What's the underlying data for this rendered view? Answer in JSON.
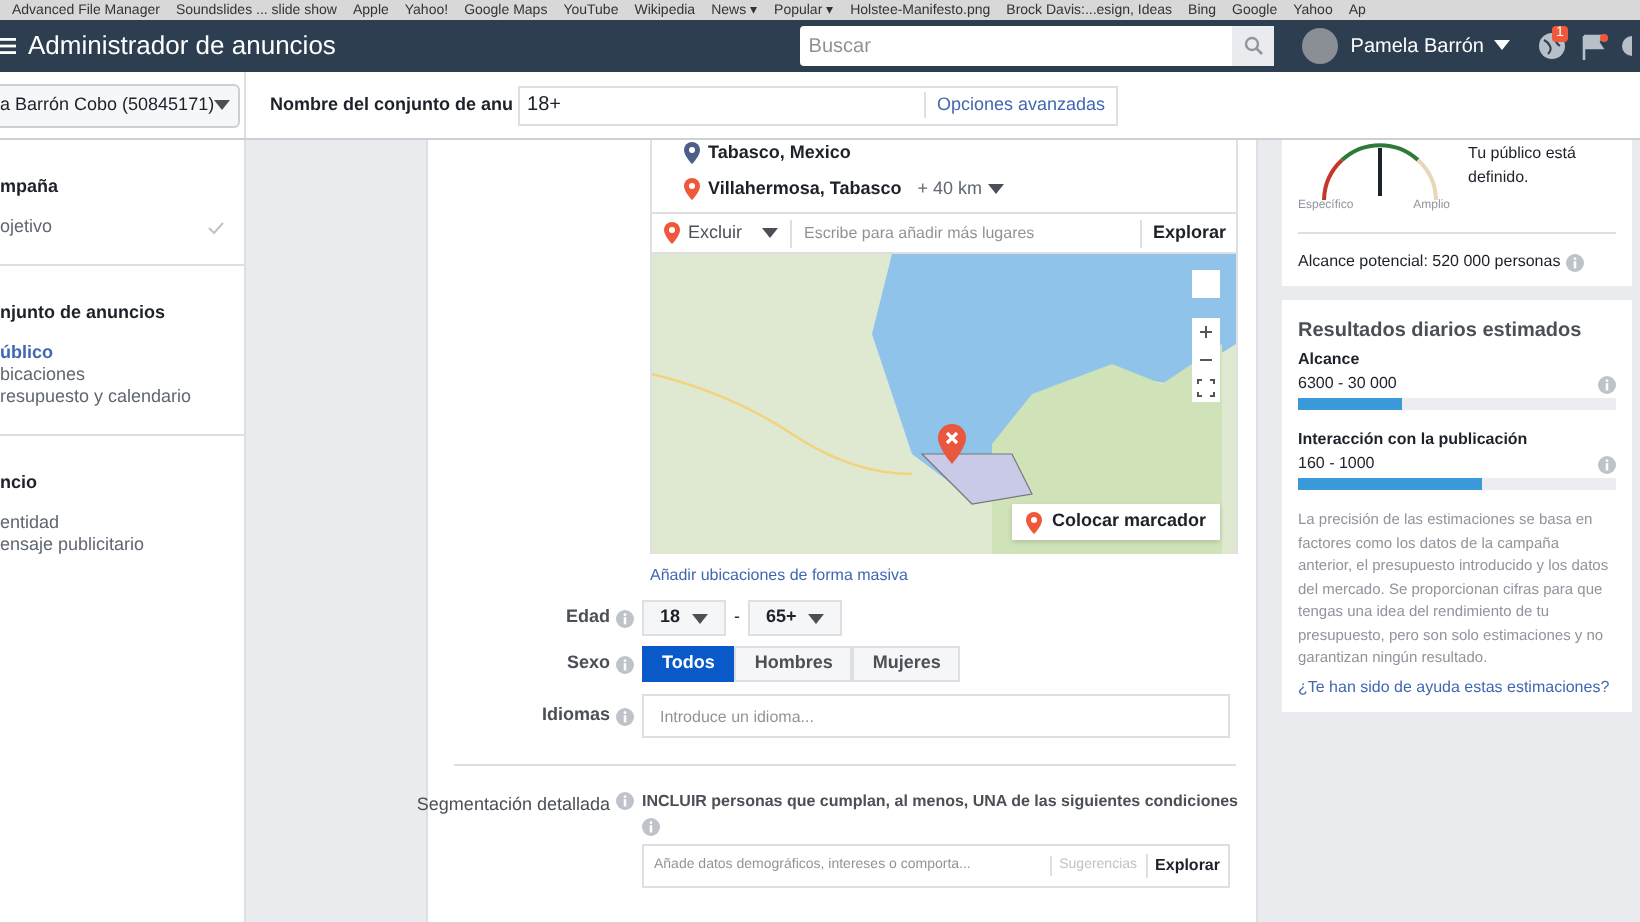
{
  "bookmarks": [
    "Advanced File Manager",
    "Soundslides ... slide show",
    "Apple",
    "Yahoo!",
    "Google Maps",
    "YouTube",
    "Wikipedia",
    "News ▾",
    "Popular ▾",
    "Holstee-Manifesto.png",
    "Brock Davis:...esign, Ideas",
    "Bing",
    "Google",
    "Yahoo",
    "Ap"
  ],
  "header": {
    "title": "Administrador de anuncios",
    "search": {
      "placeholder": "Buscar"
    },
    "user": "Pamela Barrón",
    "notifications": "1"
  },
  "account": "a Barrón Cobo (50845171)",
  "ad_set_name": {
    "label": "Nombre del conjunto de anu",
    "value": "18+",
    "link": "Opciones avanzadas"
  },
  "sidebar": [
    {
      "heading": "mpaña",
      "items": [
        {
          "label": "ojetivo",
          "selected": false,
          "done": true
        }
      ]
    },
    {
      "heading": "njunto de anuncios",
      "items": [
        {
          "label": "úblico",
          "selected": true,
          "done": false
        },
        {
          "label": "bicaciones",
          "selected": false,
          "done": false
        },
        {
          "label": "resupuesto y calendario",
          "selected": false,
          "done": false
        }
      ]
    },
    {
      "heading": "ncio",
      "items": [
        {
          "label": "entidad",
          "selected": false,
          "done": false
        },
        {
          "label": "ensaje publicitario",
          "selected": false,
          "done": false
        }
      ]
    }
  ],
  "locations": [
    {
      "name": "Tabasco, Mexico",
      "kind": "region"
    },
    {
      "name": "Villahermosa, Tabasco",
      "kind": "city",
      "radius": "+ 40 km"
    }
  ],
  "location_bar": {
    "mode": "Excluir",
    "placeholder": "Escribe para añadir más lugares",
    "button": "Explorar"
  },
  "map": {
    "drop_pin": "Colocar marcador"
  },
  "bulk_link": "Añadir ubicaciones de forma masiva",
  "age": {
    "label": "Edad",
    "min": "18",
    "sep": "-",
    "max": "65+"
  },
  "gender": {
    "label": "Sexo",
    "options": [
      {
        "label": "Todos",
        "selected": true
      },
      {
        "label": "Hombres",
        "selected": false
      },
      {
        "label": "Mujeres",
        "selected": false
      }
    ]
  },
  "languages": {
    "label": "Idiomas",
    "placeholder": "Introduce un idioma..."
  },
  "detailed": {
    "label": "Segmentación detallada",
    "text": "INCLUIR personas que cumplan, al menos, UNA de las siguientes condiciones",
    "placeholder": "Añade datos demográficos, intereses o comporta...",
    "suggest": "Sugerencias",
    "button": "Explorar"
  },
  "audience": {
    "status": "Tu público está definido.",
    "left": "Específico",
    "right": "Amplio",
    "reach": "Alcance potencial: 520 000 personas"
  },
  "estimates": {
    "title": "Resultados diarios estimados",
    "metrics": [
      {
        "name": "Alcance",
        "range": "6300 - 30 000",
        "level": 0.33
      },
      {
        "name": "Interacción con la publicación",
        "range": "160 - 1000",
        "level": 0.58
      }
    ],
    "note": "La precisión de las estimaciones se basa en factores como los datos de la campaña anterior, el presupuesto introducido y los datos del mercado. Se proporcionan cifras para que tengas una idea del rendimiento de tu presupuesto, pero son solo estimaciones y no garantizan ningún resultado.",
    "link": "¿Te han sido de ayuda estas estimaciones?"
  }
}
